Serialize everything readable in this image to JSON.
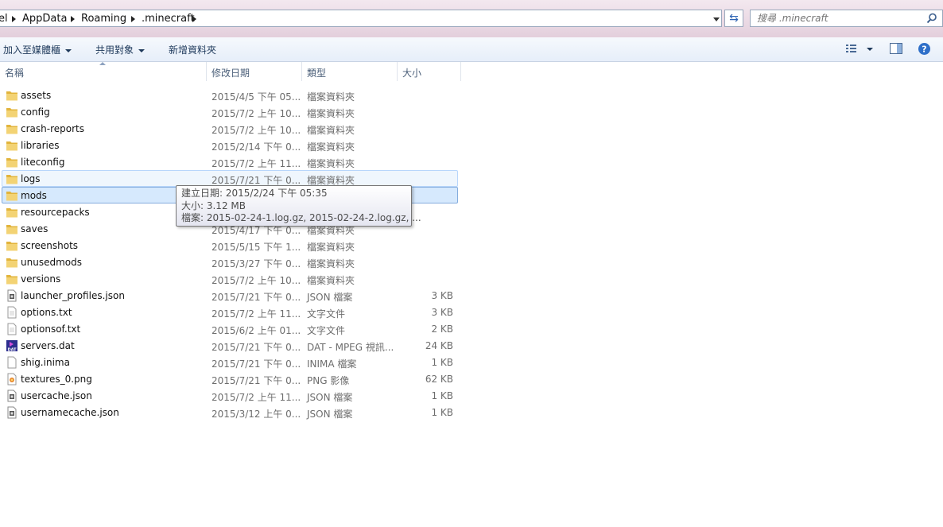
{
  "address_bar": {
    "breadcrumbs": [
      "el",
      "AppData",
      "Roaming",
      ".minecraft"
    ]
  },
  "search": {
    "placeholder": "搜尋 .minecraft"
  },
  "toolbar": {
    "add_to_library": "加入至媒體櫃",
    "share_with": "共用對象",
    "new_folder": "新增資料夾"
  },
  "columns": {
    "name": "名稱",
    "date": "修改日期",
    "type": "類型",
    "size": "大小"
  },
  "files": [
    {
      "name": "assets",
      "date": "2015/4/5 下午 05...",
      "type": "檔案資料夾",
      "size": "",
      "icon": "folder"
    },
    {
      "name": "config",
      "date": "2015/7/2 上午 10...",
      "type": "檔案資料夾",
      "size": "",
      "icon": "folder"
    },
    {
      "name": "crash-reports",
      "date": "2015/7/2 上午 10...",
      "type": "檔案資料夾",
      "size": "",
      "icon": "folder"
    },
    {
      "name": "libraries",
      "date": "2015/2/14 下午 0...",
      "type": "檔案資料夾",
      "size": "",
      "icon": "folder"
    },
    {
      "name": "liteconfig",
      "date": "2015/7/2 上午 11...",
      "type": "檔案資料夾",
      "size": "",
      "icon": "folder"
    },
    {
      "name": "logs",
      "date": "2015/7/21 下午 0...",
      "type": "檔案資料夾",
      "size": "",
      "icon": "folder",
      "state": "hover"
    },
    {
      "name": "mods",
      "date": "",
      "type": "",
      "size": "",
      "icon": "folder",
      "state": "selected"
    },
    {
      "name": "resourcepacks",
      "date": "",
      "type": "",
      "size": "",
      "icon": "folder"
    },
    {
      "name": "saves",
      "date": "2015/4/17 下午 0...",
      "type": "檔案資料夾",
      "size": "",
      "icon": "folder"
    },
    {
      "name": "screenshots",
      "date": "2015/5/15 下午 1...",
      "type": "檔案資料夾",
      "size": "",
      "icon": "folder"
    },
    {
      "name": "unusedmods",
      "date": "2015/3/27 下午 0...",
      "type": "檔案資料夾",
      "size": "",
      "icon": "folder"
    },
    {
      "name": "versions",
      "date": "2015/7/2 上午 10...",
      "type": "檔案資料夾",
      "size": "",
      "icon": "folder"
    },
    {
      "name": "launcher_profiles.json",
      "date": "2015/7/21 下午 0...",
      "type": "JSON 檔案",
      "size": "3 KB",
      "icon": "json-file"
    },
    {
      "name": "options.txt",
      "date": "2015/7/2 上午 11...",
      "type": "文字文件",
      "size": "3 KB",
      "icon": "text-file"
    },
    {
      "name": "optionsof.txt",
      "date": "2015/6/2 上午 01...",
      "type": "文字文件",
      "size": "2 KB",
      "icon": "text-file"
    },
    {
      "name": "servers.dat",
      "date": "2015/7/21 下午 0...",
      "type": "DAT - MPEG 視訊...",
      "size": "24 KB",
      "icon": "dat-file"
    },
    {
      "name": "shig.inima",
      "date": "2015/7/21 下午 0...",
      "type": "INIMA 檔案",
      "size": "1 KB",
      "icon": "blank-file"
    },
    {
      "name": "textures_0.png",
      "date": "2015/7/21 下午 0...",
      "type": "PNG 影像",
      "size": "62 KB",
      "icon": "png-file"
    },
    {
      "name": "usercache.json",
      "date": "2015/7/2 上午 11...",
      "type": "JSON 檔案",
      "size": "1 KB",
      "icon": "json-file"
    },
    {
      "name": "usernamecache.json",
      "date": "2015/3/12 上午 0...",
      "type": "JSON 檔案",
      "size": "1 KB",
      "icon": "json-file"
    }
  ],
  "tooltip": {
    "created": "建立日期: 2015/2/24 下午 05:35",
    "size": "大小: 3.12 MB",
    "files": "檔案: 2015-02-24-1.log.gz, 2015-02-24-2.log.gz, ..."
  },
  "colors": {
    "selection": "#d6e9fd",
    "hover": "#eff6fd",
    "folder": "#e8c14e"
  }
}
